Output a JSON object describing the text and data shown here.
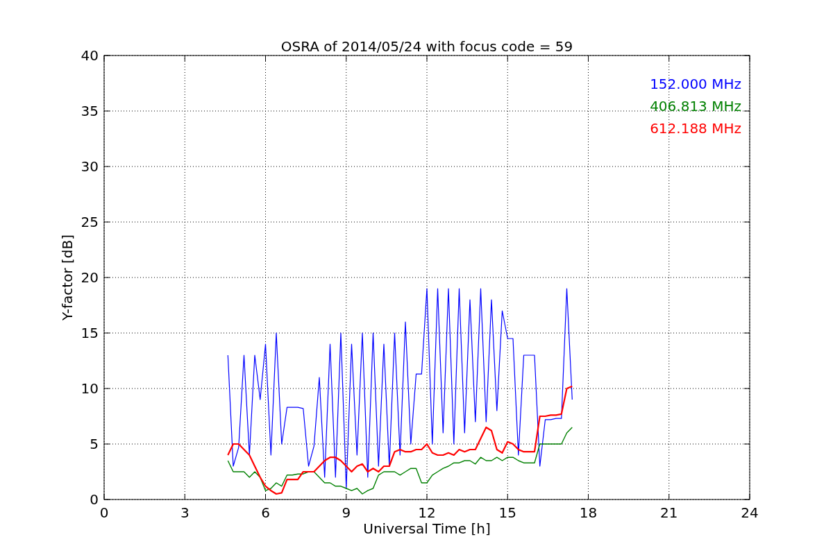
{
  "figure": {
    "chart_data": {
      "type": "line",
      "title": "OSRA of 2014/05/24 with focus code = 59",
      "xlabel": "Universal Time [h]",
      "ylabel": "Y-factor [dB]",
      "xlim": [
        0,
        24
      ],
      "ylim": [
        0,
        40
      ],
      "grid": true,
      "xticks": [
        0,
        3,
        6,
        9,
        12,
        15,
        18,
        21,
        24
      ],
      "yticks": [
        0,
        5,
        10,
        15,
        20,
        25,
        30,
        35,
        40
      ],
      "x": [
        4.6,
        4.8,
        5.0,
        5.2,
        5.4,
        5.6,
        5.8,
        6.0,
        6.2,
        6.4,
        6.6,
        6.8,
        7.0,
        7.2,
        7.4,
        7.6,
        7.8,
        8.0,
        8.2,
        8.4,
        8.6,
        8.8,
        9.0,
        9.2,
        9.4,
        9.6,
        9.8,
        10.0,
        10.2,
        10.4,
        10.6,
        10.8,
        11.0,
        11.2,
        11.4,
        11.6,
        11.8,
        12.0,
        12.2,
        12.4,
        12.6,
        12.8,
        13.0,
        13.2,
        13.4,
        13.6,
        13.8,
        14.0,
        14.2,
        14.4,
        14.6,
        14.8,
        15.0,
        15.2,
        15.4,
        15.6,
        15.8,
        16.0,
        16.2,
        16.4,
        16.6,
        16.8,
        17.0,
        17.2,
        17.4
      ],
      "series": [
        {
          "name": "152.000 MHz",
          "color": "#0000ff",
          "values": [
            13,
            3,
            4.7,
            13,
            4,
            13,
            9,
            14,
            4,
            15,
            5,
            8.3,
            8.3,
            8.3,
            8.2,
            3,
            4.8,
            11,
            2,
            14,
            2,
            15,
            1,
            14,
            4,
            15,
            2,
            15,
            3,
            14,
            3,
            15,
            4,
            16,
            5,
            11.3,
            11.3,
            19,
            5,
            19,
            6,
            19,
            5,
            19,
            6,
            18,
            7,
            19,
            7,
            18,
            8,
            17,
            14.5,
            14.5,
            4,
            13,
            13,
            13,
            3,
            7.2,
            7.2,
            7.3,
            7.3,
            19,
            9
          ]
        },
        {
          "name": "406.813 MHz",
          "color": "#008000",
          "values": [
            3.5,
            2.5,
            2.5,
            2.5,
            2,
            2.5,
            2,
            0.8,
            1,
            1.5,
            1.2,
            2.2,
            2.2,
            2.3,
            2.3,
            2.5,
            2.5,
            2,
            1.5,
            1.5,
            1.2,
            1.2,
            1,
            0.8,
            1,
            0.5,
            0.8,
            1,
            2.2,
            2.5,
            2.5,
            2.5,
            2.2,
            2.5,
            2.8,
            2.8,
            1.5,
            1.5,
            2.2,
            2.5,
            2.8,
            3,
            3.3,
            3.3,
            3.5,
            3.5,
            3.2,
            3.8,
            3.5,
            3.5,
            3.8,
            3.5,
            3.8,
            3.8,
            3.5,
            3.3,
            3.3,
            3.3,
            5,
            5,
            5,
            5,
            5,
            6,
            6.5
          ]
        },
        {
          "name": "612.188 MHz",
          "color": "#ff0000",
          "values": [
            4,
            5,
            5,
            4.5,
            4,
            3,
            2,
            1.2,
            0.8,
            0.5,
            0.6,
            1.8,
            1.8,
            1.8,
            2.5,
            2.5,
            2.5,
            3,
            3.5,
            3.8,
            3.8,
            3.5,
            3,
            2.5,
            3,
            3.2,
            2.5,
            2.8,
            2.5,
            3,
            3,
            4.3,
            4.5,
            4.3,
            4.3,
            4.5,
            4.5,
            5,
            4.2,
            4,
            4,
            4.2,
            4,
            4.5,
            4.3,
            4.5,
            4.5,
            5.5,
            6.5,
            6.2,
            4.5,
            4.2,
            5.2,
            5,
            4.5,
            4.3,
            4.3,
            4.3,
            7.5,
            7.5,
            7.6,
            7.6,
            7.7,
            10,
            10.2
          ]
        }
      ]
    }
  }
}
